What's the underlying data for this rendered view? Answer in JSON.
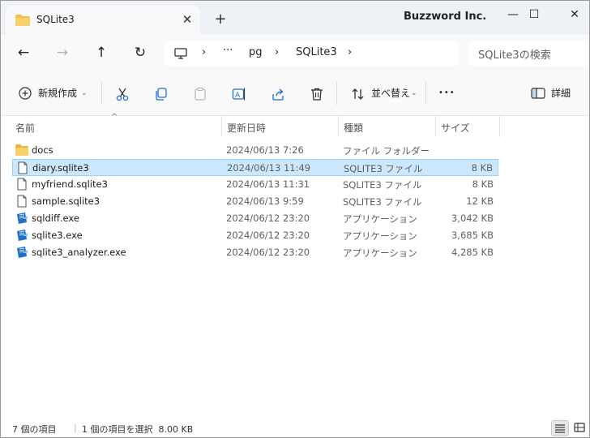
{
  "tab": {
    "title": "SQLite3",
    "close": "✕",
    "new_tab": "+"
  },
  "brand": "Buzzword Inc.",
  "window_controls": {
    "minimize": "—",
    "maximize": "☐",
    "close": "✕"
  },
  "nav": {
    "back": "←",
    "forward": "→",
    "up": "↑",
    "refresh": "↻"
  },
  "address": {
    "computer_icon": "computer-icon",
    "chevron": "›",
    "ellipsis": "···",
    "crumbs": [
      "pg",
      "SQLite3"
    ]
  },
  "search": {
    "placeholder": "SQLite3の検索"
  },
  "toolbar": {
    "new_label": "新規作成",
    "sort_label": "並べ替え",
    "more": "•••",
    "details_label": "詳細"
  },
  "columns": {
    "name": "名前",
    "date": "更新日時",
    "type": "種類",
    "size": "サイズ"
  },
  "files": [
    {
      "icon": "folder-icon",
      "name": "docs",
      "date": "2024/06/13 7:26",
      "type": "ファイル フォルダー",
      "size": "",
      "selected": false
    },
    {
      "icon": "file-icon",
      "name": "diary.sqlite3",
      "date": "2024/06/13 11:49",
      "type": "SQLITE3 ファイル",
      "size": "8 KB",
      "selected": true
    },
    {
      "icon": "file-icon",
      "name": "myfriend.sqlite3",
      "date": "2024/06/13 11:31",
      "type": "SQLITE3 ファイル",
      "size": "8 KB",
      "selected": false
    },
    {
      "icon": "file-icon",
      "name": "sample.sqlite3",
      "date": "2024/06/13 9:59",
      "type": "SQLITE3 ファイル",
      "size": "12 KB",
      "selected": false
    },
    {
      "icon": "exe-icon",
      "name": "sqldiff.exe",
      "date": "2024/06/12 23:20",
      "type": "アプリケーション",
      "size": "3,042 KB",
      "selected": false
    },
    {
      "icon": "exe-icon",
      "name": "sqlite3.exe",
      "date": "2024/06/12 23:20",
      "type": "アプリケーション",
      "size": "3,685 KB",
      "selected": false
    },
    {
      "icon": "exe-icon",
      "name": "sqlite3_analyzer.exe",
      "date": "2024/06/12 23:20",
      "type": "アプリケーション",
      "size": "4,285 KB",
      "selected": false
    }
  ],
  "status": {
    "item_count": "7 個の項目",
    "selection": "1 個の項目を選択  8.00 KB"
  },
  "colors": {
    "selected_row": "#cce8ff",
    "folder": "#f0c040",
    "exe": "#1e6fc8"
  }
}
